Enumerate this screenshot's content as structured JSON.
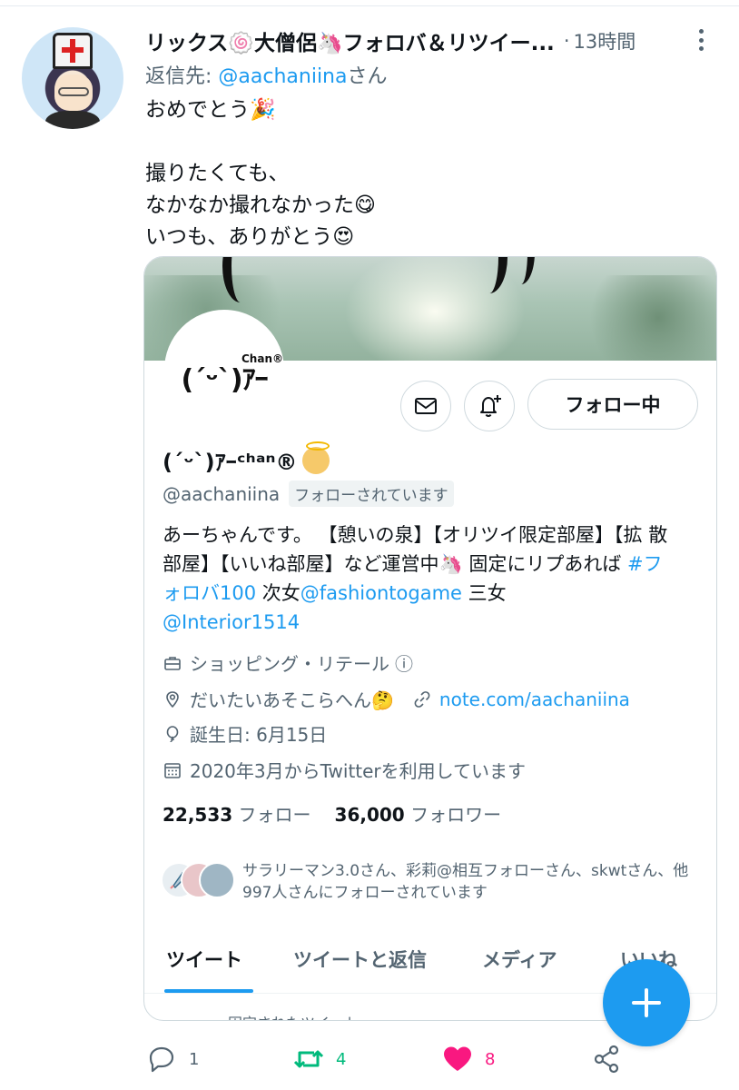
{
  "tweet": {
    "author_name": "リックス🍥大僧侶🦄フォロバ＆リツイー...",
    "separator": "·",
    "timestamp": "13時間",
    "reply_to_prefix": "返信先: ",
    "reply_to_handle": "@aachaniina",
    "reply_to_suffix": "さん",
    "text": "おめでとう🎉\n\n撮りたくても、\nなかなか撮れなかった😋\nいつも、ありがとう😍"
  },
  "profile_card": {
    "avatar_text": "(ˊᵕˋ)ｱｰ",
    "avatar_chan": "Chan®",
    "follow_button": "フォロー中",
    "name": "(ˊᵕˋ)ｱｰᶜʰᵃⁿ®",
    "handle": "@aachaniina",
    "follows_you": "フォローされています",
    "bio_1": "あーちゃんです。 【憩いの泉】【オリツイ限定部屋】【拡 散部屋】【いいね部屋】など運営中🦄 固定にリプあれば ",
    "bio_hashtag": "#フォロバ100",
    "bio_2": " 次女",
    "bio_mention_1": "@fashiontogame",
    "bio_3": " 三女",
    "bio_mention_2": "@Interior1514",
    "category": "ショッピング・リテール",
    "category_info": "ⓘ",
    "location": "だいたいあそこらへん🤔",
    "url": "note.com/aachaniina",
    "birthday": "誕生日: 6月15日",
    "joined": "2020年3月からTwitterを利用しています",
    "following_count": "22,533",
    "following_label": "フォロー",
    "followers_count": "36,000",
    "followers_label": "フォロワー",
    "followed_by": "サラリーマン3.0さん、彩莉@相互フォローさん、skwtさん、他997人さんにフォローされています",
    "tabs": [
      "ツイート",
      "ツイートと返信",
      "メディア",
      "いいね"
    ],
    "pinned_peek": "固定されたツイート"
  },
  "actions": {
    "reply_count": "1",
    "retweet_count": "4",
    "like_count": "8"
  },
  "colors": {
    "accent": "#1d9bf0",
    "retweet": "#00ba7c",
    "like": "#f91880",
    "secondary_text": "#536471"
  }
}
